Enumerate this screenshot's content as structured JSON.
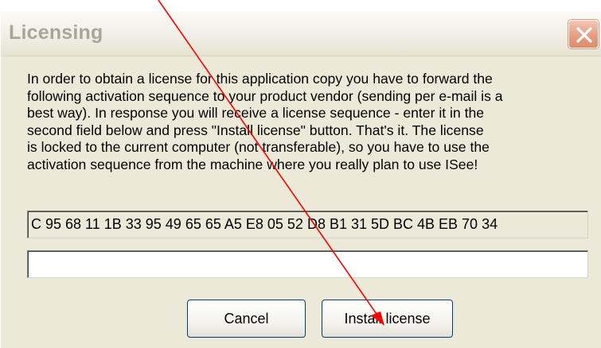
{
  "dialog": {
    "title": "Licensing",
    "close_icon": "close-icon",
    "description": "In order to obtain a license for this application copy  you have to forward the\nfollowing activation sequence to your product vendor (sending per e-mail is a\nbest way).  In response you will receive a  license sequence - enter it  in the\nsecond field below and press \"Install license\" button.  That's it.  The license\nis  locked to the current computer (not transferable),  so you have to use the\nactivation sequence from the machine where you really plan to use ISee!",
    "activation_sequence": "C 95 68 11 1B 33 95 49 65 65 A5 E8 05 52 D8 B1 31 5D BC 4B EB 70 34",
    "license_input_value": "",
    "cancel_label": "Cancel",
    "install_label": "Install license"
  },
  "annotation": {
    "color": "#ff0000"
  }
}
